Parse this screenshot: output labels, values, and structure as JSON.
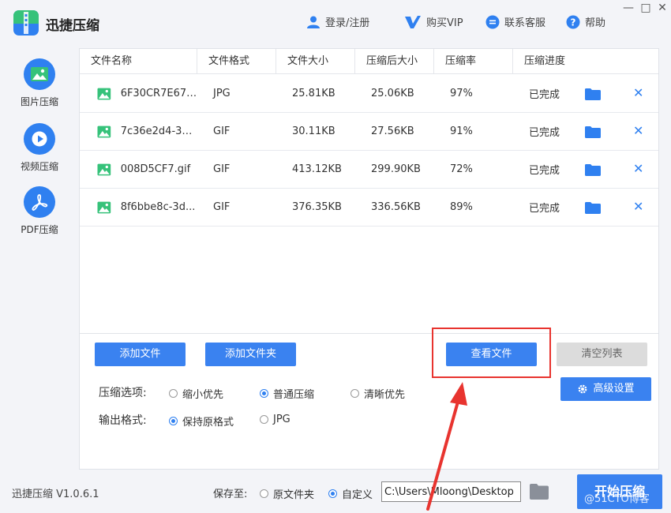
{
  "app": {
    "title": "迅捷压缩"
  },
  "header": {
    "login": "登录/注册",
    "vip": "购买VIP",
    "support": "联系客服",
    "help": "帮助"
  },
  "window_controls": {
    "minimize": "—",
    "maximize": "□",
    "close": "✕"
  },
  "sidebar": {
    "items": [
      {
        "label": "图片压缩",
        "icon": "image-icon"
      },
      {
        "label": "视频压缩",
        "icon": "play-icon"
      },
      {
        "label": "PDF压缩",
        "icon": "pdf-icon"
      }
    ]
  },
  "table": {
    "columns": [
      "文件名称",
      "文件格式",
      "文件大小",
      "压缩后大小",
      "压缩率",
      "压缩进度"
    ],
    "rows": [
      {
        "name": "6F30CR7E672...",
        "format": "JPG",
        "size": "25.81KB",
        "compressed": "25.06KB",
        "rate": "97%",
        "status": "已完成"
      },
      {
        "name": "7c36e2d4-32...",
        "format": "GIF",
        "size": "30.11KB",
        "compressed": "27.56KB",
        "rate": "91%",
        "status": "已完成"
      },
      {
        "name": "008D5CF7.gif",
        "format": "GIF",
        "size": "413.12KB",
        "compressed": "299.90KB",
        "rate": "72%",
        "status": "已完成"
      },
      {
        "name": "8f6bbe8c-3d...",
        "format": "GIF",
        "size": "376.35KB",
        "compressed": "336.56KB",
        "rate": "89%",
        "status": "已完成"
      }
    ]
  },
  "actions": {
    "add_file": "添加文件",
    "add_folder": "添加文件夹",
    "view_files": "查看文件",
    "clear_list": "清空列表",
    "advanced": "高级设置"
  },
  "options": {
    "compress_label": "压缩选项:",
    "compress_choices": [
      {
        "label": "缩小优先",
        "checked": false
      },
      {
        "label": "普通压缩",
        "checked": true
      },
      {
        "label": "清晰优先",
        "checked": false
      }
    ],
    "output_label": "输出格式:",
    "output_choices": [
      {
        "label": "保持原格式",
        "checked": true
      },
      {
        "label": "JPG",
        "checked": false
      }
    ]
  },
  "footer": {
    "version": "迅捷压缩 V1.0.6.1",
    "save_to": "保存至:",
    "save_choices": [
      {
        "label": "原文件夹",
        "checked": false
      },
      {
        "label": "自定义",
        "checked": true
      }
    ],
    "path": "C:\\Users\\Mloong\\Desktop",
    "start": "开始压缩",
    "watermark": "@51CTO博客"
  },
  "colors": {
    "accent": "#3a82f0",
    "highlight": "#e8342f",
    "disabled": "#dcdcdc"
  }
}
